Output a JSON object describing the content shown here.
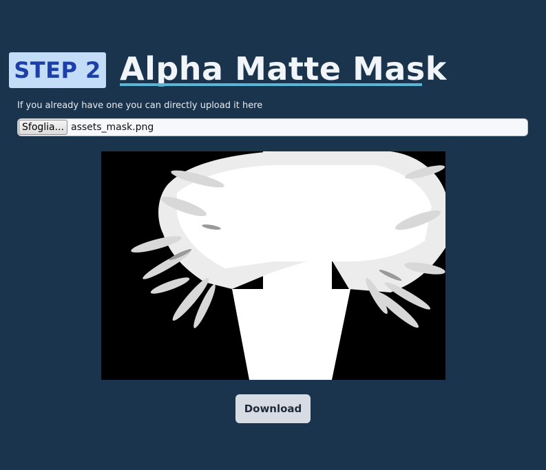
{
  "step": {
    "label": "STEP 2"
  },
  "title": "Alpha Matte Mask",
  "helper_text": "If you already have one you can directly upload it here",
  "upload": {
    "button_label": "Sfoglia...",
    "file_name": "assets_mask.png"
  },
  "preview": {
    "description_icon": "alpha-matte-mask-image"
  },
  "download": {
    "label": "Download"
  },
  "colors": {
    "background": "#1b344d",
    "badge_bg": "#c3dcf8",
    "badge_text": "#1d3fa8",
    "title_underline": "#5ab6d6",
    "button_bg": "#d7dbe3"
  }
}
